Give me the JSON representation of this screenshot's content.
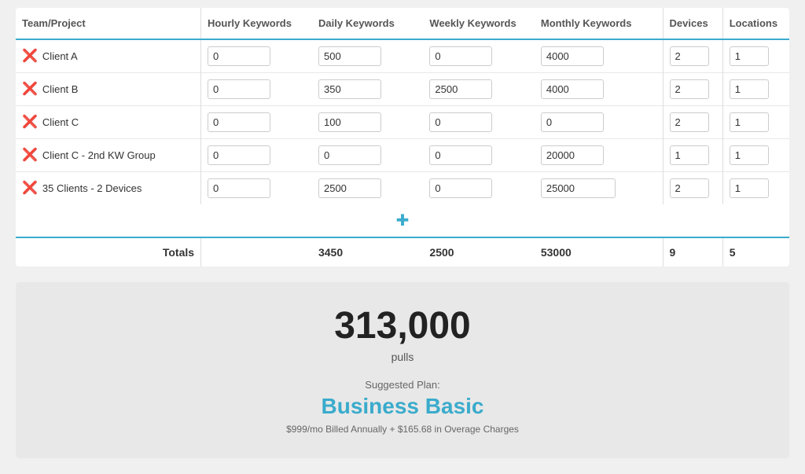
{
  "table": {
    "headers": {
      "team": "Team/Project",
      "hourly": "Hourly Keywords",
      "daily": "Daily Keywords",
      "weekly": "Weekly Keywords",
      "monthly": "Monthly Keywords",
      "devices": "Devices",
      "locations": "Locations"
    },
    "rows": [
      {
        "id": "row-1",
        "name": "Client A",
        "hourly": "0",
        "daily": "500",
        "weekly": "0",
        "monthly": "4000",
        "devices": "2",
        "locations": "1"
      },
      {
        "id": "row-2",
        "name": "Client B",
        "hourly": "0",
        "daily": "350",
        "weekly": "2500",
        "monthly": "4000",
        "devices": "2",
        "locations": "1"
      },
      {
        "id": "row-3",
        "name": "Client C",
        "hourly": "0",
        "daily": "100",
        "weekly": "0",
        "monthly": "0",
        "devices": "2",
        "locations": "1"
      },
      {
        "id": "row-4",
        "name": "Client C - 2nd KW Group",
        "hourly": "0",
        "daily": "0",
        "weekly": "0",
        "monthly": "20000",
        "devices": "1",
        "locations": "1"
      },
      {
        "id": "row-5",
        "name": "35 Clients - 2 Devices",
        "hourly": "0",
        "daily": "2500",
        "weekly": "0",
        "monthly": "25000",
        "devices": "2",
        "locations": "1"
      }
    ],
    "totals": {
      "label": "Totals",
      "hourly": "",
      "daily": "3450",
      "weekly": "2500",
      "monthly": "53000",
      "devices": "9",
      "locations": "5"
    }
  },
  "summary": {
    "pulls_number": "313,000",
    "pulls_label": "pulls",
    "suggested_label": "Suggested Plan:",
    "plan_name": "Business Basic",
    "plan_price": "$999/mo Billed Annually + $165.68 in Overage Charges"
  },
  "icons": {
    "remove": "✖",
    "add": "✚"
  }
}
